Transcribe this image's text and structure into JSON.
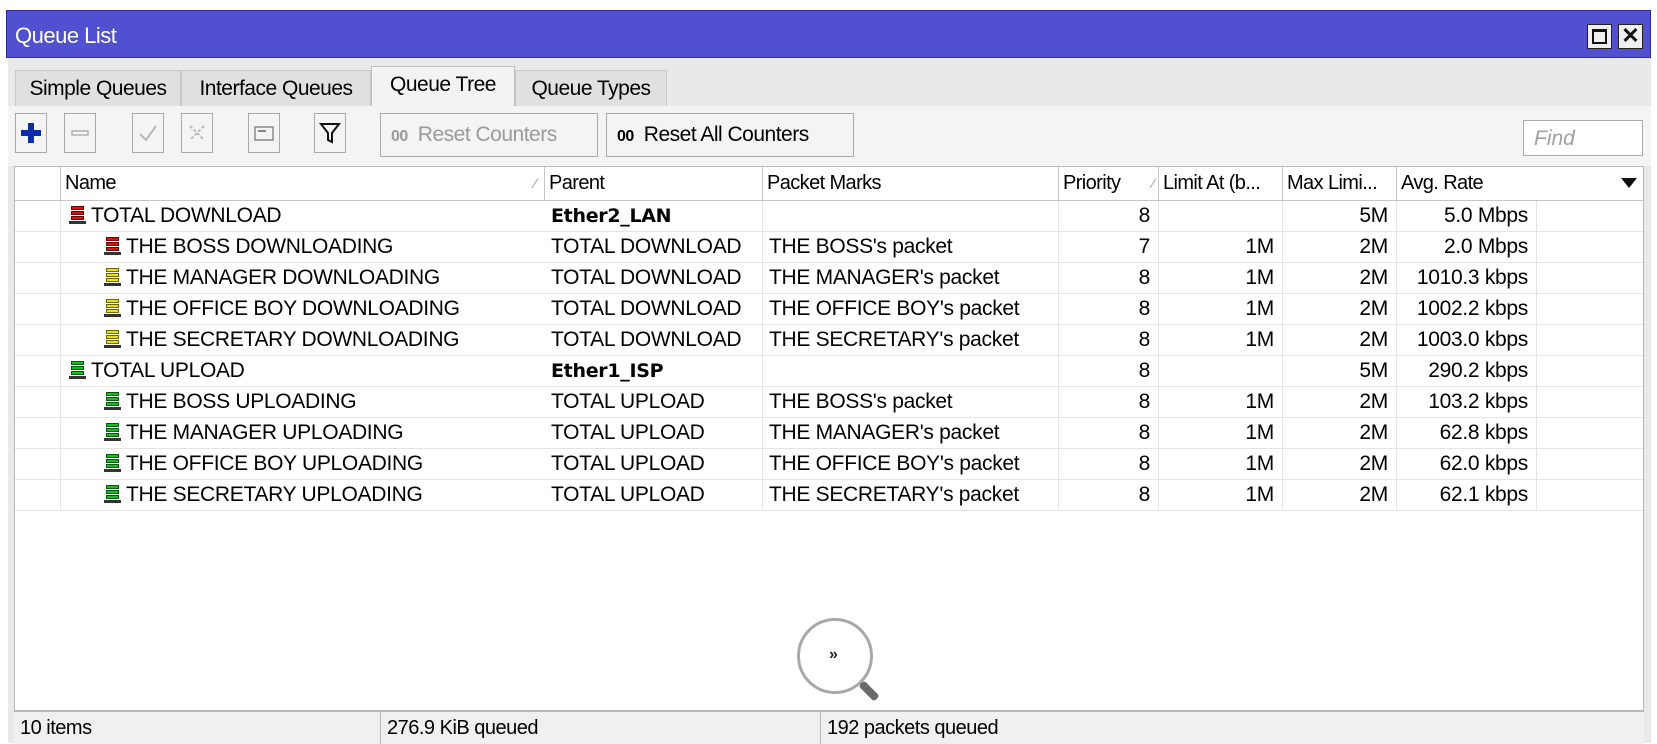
{
  "window": {
    "title": "Queue List"
  },
  "tabs": [
    {
      "label": "Simple Queues"
    },
    {
      "label": "Interface Queues"
    },
    {
      "label": "Queue Tree"
    },
    {
      "label": "Queue Types"
    }
  ],
  "toolbar": {
    "add_icon": "plus-icon",
    "remove_icon": "minus-icon",
    "enable_icon": "check-icon",
    "disable_icon": "x-icon",
    "comment_icon": "comment-icon",
    "filter_icon": "filter-icon",
    "reset_counters_prefix": "00",
    "reset_counters_label": "Reset Counters",
    "reset_all_prefix": "00",
    "reset_all_label": "Reset All Counters",
    "find_placeholder": "Find"
  },
  "table": {
    "columns": [
      "Name",
      "Parent",
      "Packet Marks",
      "Priority",
      "Limit At (b...",
      "Max Limi...",
      "Avg. Rate"
    ],
    "rows": [
      {
        "name": "TOTAL DOWNLOAD",
        "parent": "Ether2_LAN",
        "marks": "",
        "priority": "8",
        "limit_at": "",
        "max_limit": "5M",
        "avg_rate": "5.0 Mbps",
        "icon_color": "#e01010",
        "level": 0
      },
      {
        "name": "THE BOSS DOWNLOADING",
        "parent": "TOTAL DOWNLOAD",
        "marks": "THE BOSS's packet",
        "priority": "7",
        "limit_at": "1M",
        "max_limit": "2M",
        "avg_rate": "2.0 Mbps",
        "icon_color": "#e01010",
        "level": 1
      },
      {
        "name": "THE MANAGER DOWNLOADING",
        "parent": "TOTAL DOWNLOAD",
        "marks": "THE MANAGER's packet",
        "priority": "8",
        "limit_at": "1M",
        "max_limit": "2M",
        "avg_rate": "1010.3 kbps",
        "icon_color": "#f0e000",
        "level": 1
      },
      {
        "name": "THE OFFICE BOY DOWNLOADING",
        "parent": "TOTAL DOWNLOAD",
        "marks": "THE OFFICE BOY's packet",
        "priority": "8",
        "limit_at": "1M",
        "max_limit": "2M",
        "avg_rate": "1002.2 kbps",
        "icon_color": "#f0e000",
        "level": 1
      },
      {
        "name": "THE SECRETARY DOWNLOADING",
        "parent": "TOTAL DOWNLOAD",
        "marks": "THE SECRETARY's packet",
        "priority": "8",
        "limit_at": "1M",
        "max_limit": "2M",
        "avg_rate": "1003.0 kbps",
        "icon_color": "#f0e000",
        "level": 1
      },
      {
        "name": "TOTAL UPLOAD",
        "parent": "Ether1_ISP",
        "marks": "",
        "priority": "8",
        "limit_at": "",
        "max_limit": "5M",
        "avg_rate": "290.2 kbps",
        "icon_color": "#10c020",
        "level": 0
      },
      {
        "name": "THE BOSS UPLOADING",
        "parent": "TOTAL UPLOAD",
        "marks": "THE BOSS's packet",
        "priority": "8",
        "limit_at": "1M",
        "max_limit": "2M",
        "avg_rate": "103.2 kbps",
        "icon_color": "#10c020",
        "level": 1
      },
      {
        "name": "THE MANAGER UPLOADING",
        "parent": "TOTAL UPLOAD",
        "marks": "THE MANAGER's packet",
        "priority": "8",
        "limit_at": "1M",
        "max_limit": "2M",
        "avg_rate": "62.8 kbps",
        "icon_color": "#10c020",
        "level": 1
      },
      {
        "name": "THE OFFICE BOY UPLOADING",
        "parent": "TOTAL UPLOAD",
        "marks": "THE OFFICE BOY's packet",
        "priority": "8",
        "limit_at": "1M",
        "max_limit": "2M",
        "avg_rate": "62.0 kbps",
        "icon_color": "#10c020",
        "level": 1
      },
      {
        "name": "THE SECRETARY UPLOADING",
        "parent": "TOTAL UPLOAD",
        "marks": "THE SECRETARY's packet",
        "priority": "8",
        "limit_at": "1M",
        "max_limit": "2M",
        "avg_rate": "62.1 kbps",
        "icon_color": "#10c020",
        "level": 1
      }
    ]
  },
  "status": {
    "items": "10 items",
    "queued": "276.9 KiB queued",
    "packets": "192 packets queued",
    "more_label": "»"
  }
}
